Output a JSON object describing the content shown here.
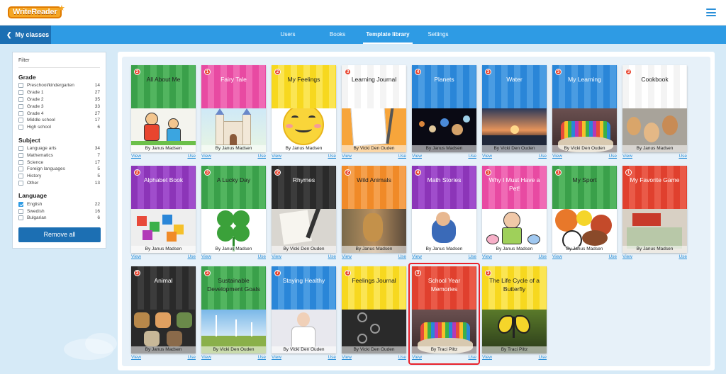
{
  "header": {
    "logo_text": "WriteReader",
    "logo_star": "★",
    "menu_icon": "hamburger-menu-icon"
  },
  "nav": {
    "back_label": "My classes",
    "back_icon": "chevron-left-icon",
    "tabs": [
      {
        "label": "Users",
        "active": false
      },
      {
        "label": "Books",
        "active": false
      },
      {
        "label": "Template library",
        "active": true
      },
      {
        "label": "Settings",
        "active": false
      }
    ]
  },
  "filter": {
    "title": "Filter",
    "groups": [
      {
        "title": "Grade",
        "options": [
          {
            "label": "Preschool/kindergarten",
            "count": "14",
            "checked": false
          },
          {
            "label": "Grade 1",
            "count": "27",
            "checked": false
          },
          {
            "label": "Grade 2",
            "count": "35",
            "checked": false
          },
          {
            "label": "Grade 3",
            "count": "33",
            "checked": false
          },
          {
            "label": "Grade 4",
            "count": "27",
            "checked": false
          },
          {
            "label": "Middle school",
            "count": "17",
            "checked": false
          },
          {
            "label": "High school",
            "count": "6",
            "checked": false
          }
        ]
      },
      {
        "title": "Subject",
        "options": [
          {
            "label": "Language arts",
            "count": "34",
            "checked": false
          },
          {
            "label": "Mathematics",
            "count": "7",
            "checked": false
          },
          {
            "label": "Science",
            "count": "17",
            "checked": false
          },
          {
            "label": "Foreign languages",
            "count": "5",
            "checked": false
          },
          {
            "label": "History",
            "count": "5",
            "checked": false
          },
          {
            "label": "Other",
            "count": "13",
            "checked": false
          }
        ]
      },
      {
        "title": "Language",
        "options": [
          {
            "label": "English",
            "count": "22",
            "checked": true
          },
          {
            "label": "Swedish",
            "count": "16",
            "checked": false
          },
          {
            "label": "Bulgarian",
            "count": "6",
            "checked": false
          }
        ]
      }
    ],
    "remove_all_label": "Remove all"
  },
  "books": [
    {
      "title": "All About Me",
      "author": "By Janus Madsen",
      "badge": "2",
      "color": "#3aa04a",
      "stripe": "#52b55f",
      "text_color": "#222",
      "art": "kids-drawing"
    },
    {
      "title": "Fairy Tale",
      "author": "By Janus Madsen",
      "badge": "1",
      "color": "#e84aa2",
      "stripe": "#f06ab5",
      "text_color": "#fff",
      "art": "castle"
    },
    {
      "title": "My Feelings",
      "author": "By Janus Madsen",
      "badge": "2",
      "color": "#f7d81f",
      "stripe": "#fbe553",
      "text_color": "#222",
      "art": "emoji"
    },
    {
      "title": "Learning Journal",
      "author": "By Vicki Den Ouden",
      "badge": "3",
      "color": "#f4f4f4",
      "stripe": "#ffffff",
      "text_color": "#222",
      "art": "notebook"
    },
    {
      "title": "Planets",
      "author": "By Janus Madsen",
      "badge": "4",
      "color": "#2a86d8",
      "stripe": "#4a9ce2",
      "text_color": "#fff",
      "art": "planets"
    },
    {
      "title": "Water",
      "author": "By Vicki Den Ouden",
      "badge": "3",
      "color": "#2a86d8",
      "stripe": "#4a9ce2",
      "text_color": "#fff",
      "art": "sunset"
    },
    {
      "title": "My Learning",
      "author": "By Vicki Den Ouden",
      "badge": "3",
      "color": "#2a86d8",
      "stripe": "#4a9ce2",
      "text_color": "#fff",
      "art": "pencils"
    },
    {
      "title": "Cookbook",
      "author": "By Janus Madsen",
      "badge": "3",
      "color": "#f4f4f4",
      "stripe": "#ffffff",
      "text_color": "#222",
      "art": "eggs"
    },
    {
      "title": "Alphabet Book",
      "author": "By Janus Madsen",
      "badge": "2",
      "color": "#8c35b8",
      "stripe": "#a04dcc",
      "text_color": "#fff",
      "art": "letters"
    },
    {
      "title": "A Lucky Day",
      "author": "By Janus Madsen",
      "badge": "3",
      "color": "#3aa04a",
      "stripe": "#52b55f",
      "text_color": "#222",
      "art": "clover"
    },
    {
      "title": "Rhymes",
      "author": "By Vicki Den Ouden",
      "badge": "2",
      "color": "#2a2a2a",
      "stripe": "#3c3c3c",
      "text_color": "#fff",
      "art": "quill"
    },
    {
      "title": "Wild Animals",
      "author": "By Janus Madsen",
      "badge": "2",
      "color": "#f08a28",
      "stripe": "#f5a04d",
      "text_color": "#222",
      "art": "animals"
    },
    {
      "title": "Math Stories",
      "author": "By Janus Madsen",
      "badge": "4",
      "color": "#8c35b8",
      "stripe": "#a04dcc",
      "text_color": "#fff",
      "art": "numbers"
    },
    {
      "title": "Why I Must Have a Pet!",
      "author": "By Janus Madsen",
      "badge": "1",
      "color": "#e84aa2",
      "stripe": "#f06ab5",
      "text_color": "#fff",
      "art": "pets"
    },
    {
      "title": "My Sport",
      "author": "By Janus Madsen",
      "badge": "1",
      "color": "#3aa04a",
      "stripe": "#52b55f",
      "text_color": "#222",
      "art": "balls"
    },
    {
      "title": "My Favorite Game",
      "author": "By Janus Madsen",
      "badge": "1",
      "color": "#e0402e",
      "stripe": "#ea5a48",
      "text_color": "#fff",
      "art": "boardgame"
    },
    {
      "title": "Animal",
      "author": "By Janus Madsen",
      "badge": "3",
      "color": "#2a2a2a",
      "stripe": "#3c3c3c",
      "text_color": "#fff",
      "art": "hexagons"
    },
    {
      "title": "Sustainable Development Goals",
      "author": "By Vicki Den Ouden",
      "badge": "3",
      "color": "#3aa04a",
      "stripe": "#52b55f",
      "text_color": "#222",
      "art": "windmills"
    },
    {
      "title": "Staying Healthy",
      "author": "By Vicki Den Ouden",
      "badge": "7",
      "color": "#2a86d8",
      "stripe": "#4a9ce2",
      "text_color": "#fff",
      "art": "doctor"
    },
    {
      "title": "Feelings Journal",
      "author": "By Vicki Den Ouden",
      "badge": "3",
      "color": "#f7d81f",
      "stripe": "#fbe553",
      "text_color": "#222",
      "art": "chalkboard"
    },
    {
      "title": "School Year Memories",
      "author": "By Traci Piltz",
      "badge": "3",
      "color": "#e0402e",
      "stripe": "#ea5a48",
      "text_color": "#fff",
      "art": "pencils"
    },
    {
      "title": "The Life Cycle of a Butterfly",
      "author": "By Traci Piltz",
      "badge": "3",
      "color": "#f7d81f",
      "stripe": "#fbe553",
      "text_color": "#222",
      "art": "butterfly"
    }
  ],
  "link_view": "View",
  "link_use": "Use",
  "highlighted_book_index": 20,
  "colors": {
    "accent": "#2e9be4",
    "dark_accent": "#1c6fb3",
    "background": "#d6eaf7",
    "highlight": "#e8202a"
  }
}
